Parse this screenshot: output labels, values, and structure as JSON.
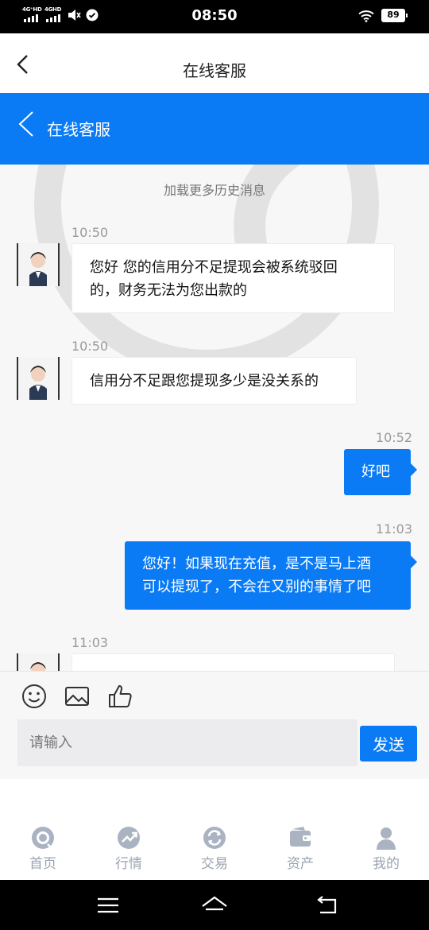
{
  "status_bar": {
    "time": "08:50",
    "signal1": "4G⁺HD",
    "signal2": "4GHD",
    "battery": "89"
  },
  "nav": {
    "title": "在线客服"
  },
  "header": {
    "title": "在线客服"
  },
  "chat": {
    "load_more": "加载更多历史消息",
    "messages": [
      {
        "side": "in",
        "time": "10:50",
        "lines": [
          "您好 您的信用分不足提现会被系统驳回",
          "的，财务无法为您出款的"
        ]
      },
      {
        "side": "in",
        "time": "10:50",
        "lines": [
          "信用分不足跟您提现多少是没关系的"
        ]
      },
      {
        "side": "out",
        "time": "10:52",
        "lines": [
          "好吧"
        ]
      },
      {
        "side": "out",
        "time": "11:03",
        "lines": [
          "您好！如果现在充值，是不是马上酒",
          "可以提现了，不会在又别的事情了吧"
        ]
      },
      {
        "side": "in",
        "time": "11:03",
        "lines": [
          ""
        ]
      }
    ]
  },
  "composer": {
    "placeholder": "请输入",
    "send_label": "发送",
    "tools": [
      "emoji-icon",
      "image-icon",
      "thumbs-up-icon"
    ]
  },
  "tabbar": {
    "items": [
      {
        "label": "首页",
        "icon": "home-icon"
      },
      {
        "label": "行情",
        "icon": "market-icon"
      },
      {
        "label": "交易",
        "icon": "trade-icon"
      },
      {
        "label": "资产",
        "icon": "wallet-icon"
      },
      {
        "label": "我的",
        "icon": "profile-icon"
      }
    ]
  },
  "colors": {
    "brand": "#0a7bf5",
    "tab_inactive": "#9aa3b2",
    "chat_bg": "#f7f7f8"
  }
}
